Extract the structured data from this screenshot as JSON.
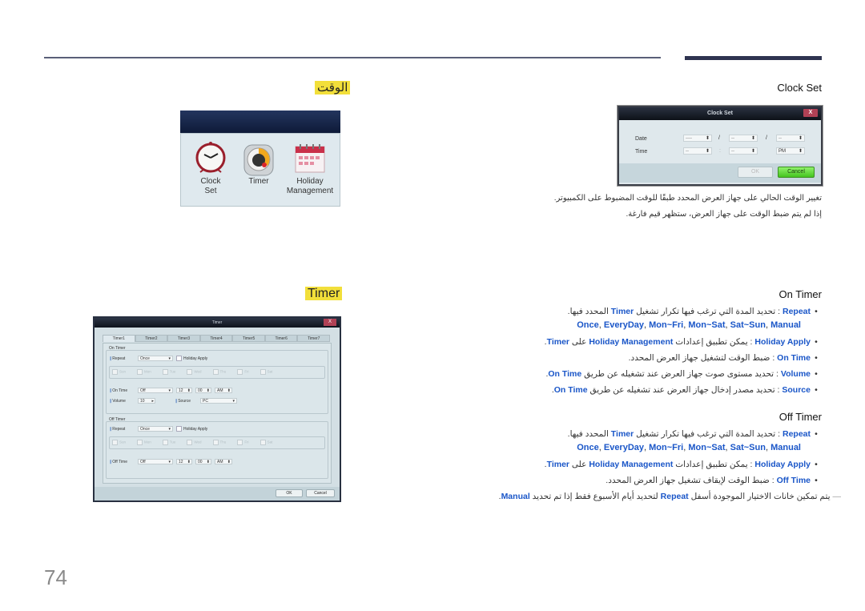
{
  "page_number": "74",
  "sections": {
    "time_ar": "الوقت",
    "timer": "Timer"
  },
  "icon_panel": {
    "items": [
      {
        "label_line1": "Clock",
        "label_line2": "Set",
        "icon": "alarm-clock-icon"
      },
      {
        "label_line1": "Timer",
        "label_line2": "",
        "icon": "timer-dial-icon"
      },
      {
        "label_line1": "Holiday",
        "label_line2": "Management",
        "icon": "calendar-icon"
      }
    ]
  },
  "clock_set": {
    "heading": "Clock Set",
    "dialog": {
      "title": "Clock Set",
      "close": "X",
      "date_label": "Date",
      "time_label": "Time",
      "date_fields": [
        "----",
        "--",
        "--"
      ],
      "date_sep": "/",
      "time_fields": [
        "--",
        "--",
        "PM"
      ],
      "time_sep": ":",
      "ok": "OK",
      "cancel": "Cancel"
    },
    "desc_line1": "تغيير الوقت الحالي على جهاز العرض المحدد طبقًا للوقت المضبوط على الكمبيوتر.",
    "desc_line2": "إذا لم يتم ضبط الوقت على جهاز العرض، ستظهر قيم فارغة."
  },
  "timer_dialog": {
    "title": "Timer",
    "close": "X",
    "tabs": [
      "Timer1",
      "Timer2",
      "Timer3",
      "Timer4",
      "Timer5",
      "Timer6",
      "Timer7"
    ],
    "on_timer": {
      "group_label": "On Timer",
      "repeat_label": "Repeat",
      "repeat_value": "Once",
      "holiday_apply": "Holiday Apply",
      "days": [
        "Sun",
        "Mon",
        "Tue",
        "Wed",
        "Thu",
        "Fri",
        "Sat"
      ],
      "time_label": "On Time",
      "time_mode": "Off",
      "hour": "12",
      "minute": "00",
      "ampm": "AM",
      "volume_label": "Volume",
      "volume_value": "10",
      "source_label": "Source",
      "source_value": "PC"
    },
    "off_timer": {
      "group_label": "Off Timer",
      "repeat_label": "Repeat",
      "repeat_value": "Once",
      "holiday_apply": "Holiday Apply",
      "days": [
        "Sun",
        "Mon",
        "Tue",
        "Wed",
        "Thu",
        "Fri",
        "Sat"
      ],
      "time_label": "Off Time",
      "time_mode": "Off",
      "hour": "12",
      "minute": "00",
      "ampm": "AM"
    },
    "ok": "OK",
    "cancel": "Cancel"
  },
  "on_timer_section": {
    "heading": "On Timer",
    "repeat_term": "Repeat",
    "repeat_desc_a": " : تحديد المدة التي ترغب فيها تكرار تشغيل ",
    "repeat_desc_b": "Timer",
    "repeat_desc_c": " المحدد فيها.",
    "repeat_options": [
      "Once",
      "EveryDay",
      "Mon~Fri",
      "Mon~Sat",
      "Sat~Sun",
      "Manual"
    ],
    "holiday_term": "Holiday Apply",
    "holiday_desc_a": " : يمكن تطبيق إعدادات ",
    "holiday_desc_b": "Holiday Management",
    "holiday_desc_c": " على ",
    "holiday_desc_d": "Timer",
    "ontime_term": "On Time",
    "ontime_desc": " : ضبط الوقت لتشغيل جهاز العرض المحدد.",
    "volume_term": "Volume",
    "volume_desc_a": " : تحديد مستوى صوت جهاز العرض عند تشغيله عن طريق ",
    "volume_desc_b": "On Time",
    "source_term": "Source",
    "source_desc_a": " : تحديد مصدر إدخال جهاز العرض عند تشغيله عن طريق ",
    "source_desc_b": "On Time"
  },
  "off_timer_section": {
    "heading": "Off Timer",
    "repeat_term": "Repeat",
    "repeat_desc_a": " : تحديد المدة التي ترغب فيها تكرار تشغيل ",
    "repeat_desc_b": "Timer",
    "repeat_desc_c": " المحدد فيها.",
    "repeat_options": [
      "Once",
      "EveryDay",
      "Mon~Fri",
      "Mon~Sat",
      "Sat~Sun",
      "Manual"
    ],
    "holiday_term": "Holiday Apply",
    "holiday_desc_a": " : يمكن تطبيق إعدادات ",
    "holiday_desc_b": "Holiday Management",
    "holiday_desc_c": " على ",
    "holiday_desc_d": "Timer",
    "offtime_term": "Off Time",
    "offtime_desc": " : ضبط الوقت لإيقاف تشغيل جهاز العرض المحدد.",
    "note_a": "يتم تمكين خانات الاختيار الموجودة أسفل ",
    "note_b": "Repeat",
    "note_c": " لتحديد أيام الأسبوع فقط إذا تم تحديد ",
    "note_d": "Manual"
  }
}
